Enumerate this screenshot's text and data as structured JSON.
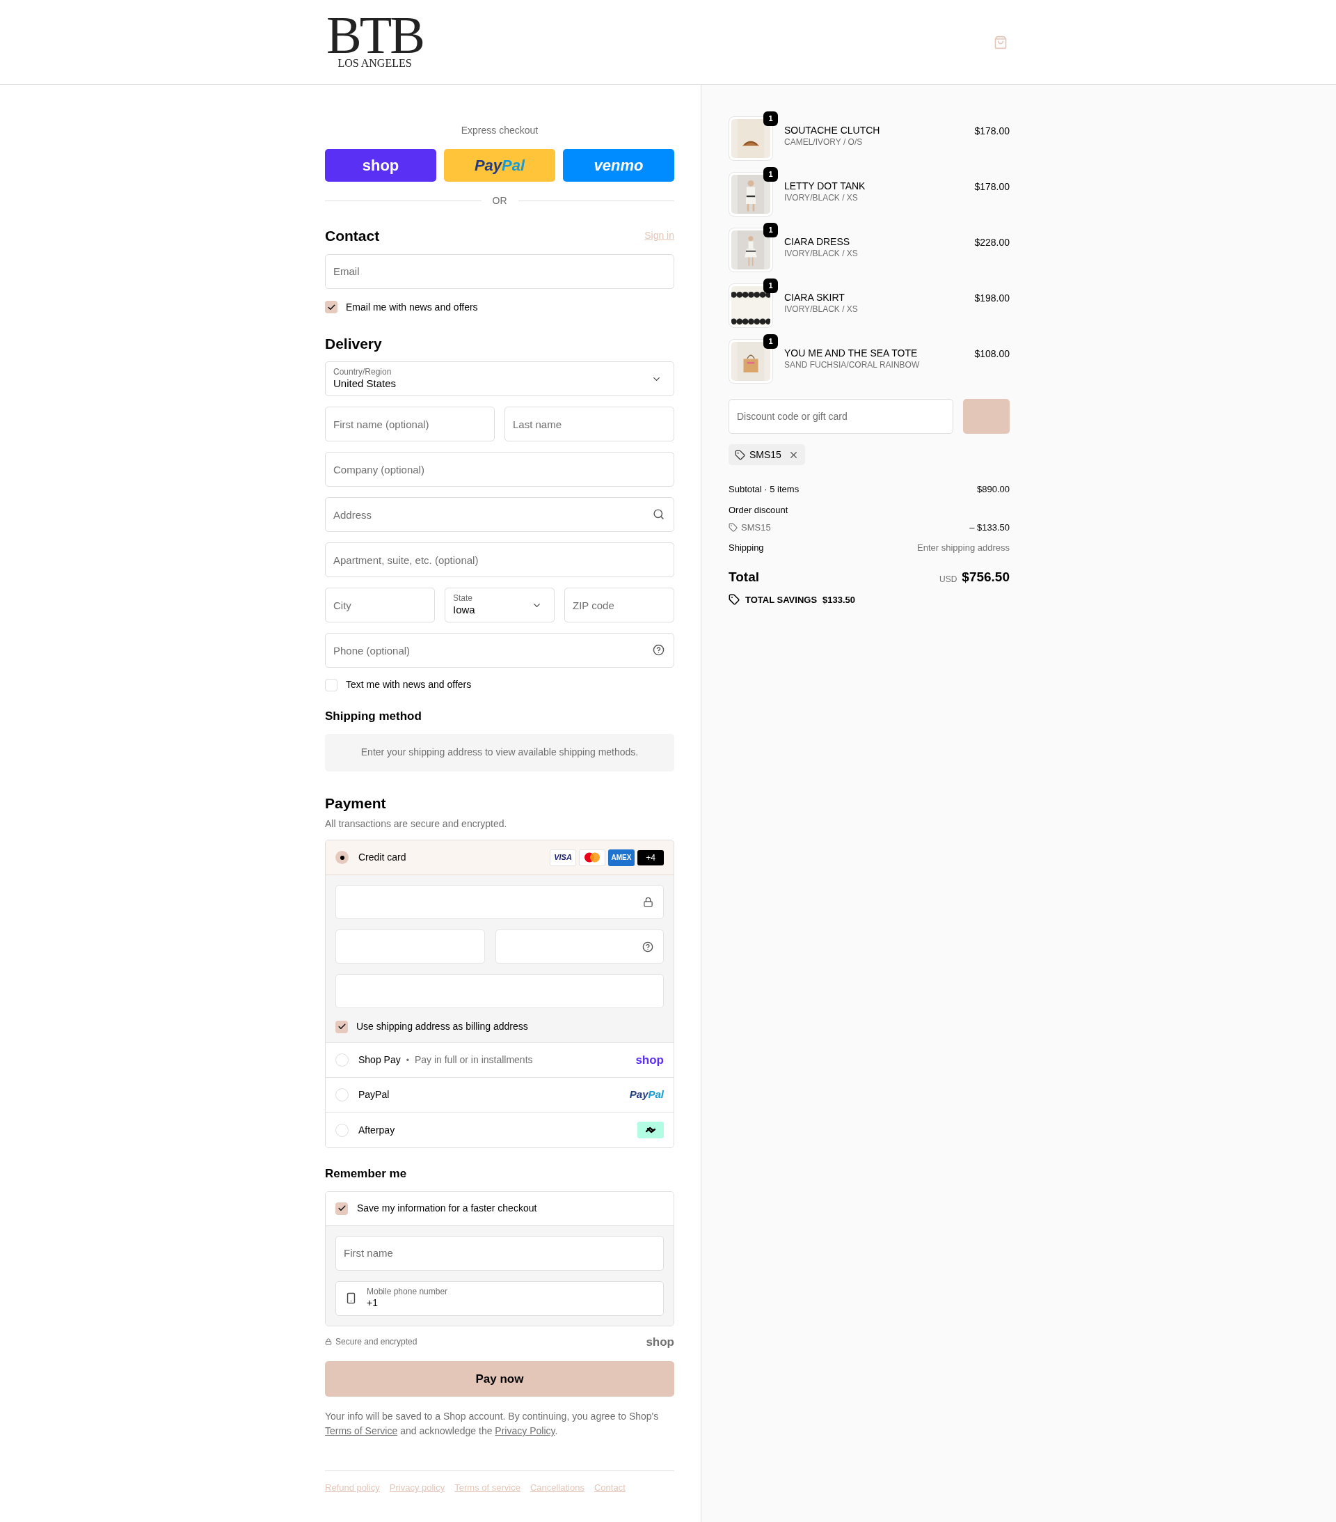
{
  "header": {
    "logo": "BTB",
    "logo_subtitle": "LOS ANGELES"
  },
  "express": {
    "title": "Express checkout",
    "buttons": [
      {
        "kind": "shop",
        "parts": [
          "shop"
        ]
      },
      {
        "kind": "paypal",
        "parts": [
          "Pay",
          "Pal"
        ]
      },
      {
        "kind": "venmo",
        "parts": [
          "venmo"
        ]
      }
    ],
    "divider": "OR"
  },
  "contact": {
    "title": "Contact",
    "sign_in": "Sign in",
    "email": {
      "placeholder": "Email"
    },
    "news": {
      "label": "Email me with news and offers",
      "checked": true
    }
  },
  "delivery": {
    "title": "Delivery",
    "rows": [
      [
        {
          "kind": "select",
          "label": "Country/Region",
          "value": "United States"
        }
      ],
      [
        {
          "kind": "input",
          "placeholder": "First name (optional)"
        },
        {
          "kind": "input",
          "placeholder": "Last name"
        }
      ],
      [
        {
          "kind": "input",
          "placeholder": "Company (optional)"
        }
      ],
      [
        {
          "kind": "search",
          "placeholder": "Address"
        }
      ],
      [
        {
          "kind": "input",
          "placeholder": "Apartment, suite, etc. (optional)"
        }
      ],
      [
        {
          "kind": "input",
          "placeholder": "City"
        },
        {
          "kind": "select",
          "label": "State",
          "value": "Iowa"
        },
        {
          "kind": "input",
          "placeholder": "ZIP code"
        }
      ],
      [
        {
          "kind": "help",
          "placeholder": "Phone (optional)"
        }
      ]
    ],
    "text_news": {
      "label": "Text me with news and offers",
      "checked": false
    }
  },
  "shipping_method": {
    "title": "Shipping method",
    "message": "Enter your shipping address to view available shipping methods."
  },
  "payment": {
    "title": "Payment",
    "subtitle": "All transactions are secure and encrypted.",
    "methods": [
      {
        "kind": "card",
        "label": "Credit card",
        "selected": true,
        "brands": [
          {
            "kind": "visa",
            "label": "VISA"
          },
          {
            "kind": "mastercard"
          },
          {
            "kind": "amex",
            "label": "AMEX"
          },
          {
            "kind": "more",
            "label": "+4"
          }
        ],
        "billing": {
          "label": "Use shipping address as billing address",
          "checked": true
        }
      },
      {
        "kind": "shop",
        "label": "Shop Pay",
        "separator": "•",
        "note": "Pay in full or in installments",
        "selected": false,
        "logo": [
          "shop"
        ]
      },
      {
        "kind": "paypal",
        "label": "PayPal",
        "selected": false,
        "logo": [
          "Pay",
          "Pal"
        ]
      },
      {
        "kind": "afterpay",
        "label": "Afterpay",
        "selected": false
      }
    ]
  },
  "remember": {
    "title": "Remember me",
    "save": {
      "label": "Save my information for a faster checkout",
      "checked": true
    },
    "first_name": {
      "placeholder": "First name"
    },
    "phone": {
      "label": "Mobile phone number",
      "value": "+1"
    }
  },
  "secure": {
    "label": "Secure and encrypted",
    "logo": "shop"
  },
  "pay_button": "Pay now",
  "legal": {
    "before": "Your info will be saved to a Shop account. By continuing, you agree to Shop's ",
    "link1": "Terms of Service",
    "middle": " and acknowledge the ",
    "link2": "Privacy Policy",
    "after": "."
  },
  "footer_links": [
    "Refund policy",
    "Privacy policy",
    "Terms of service",
    "Cancellations",
    "Contact"
  ],
  "items": [
    {
      "name": "SOUTACHE CLUTCH",
      "variant": "CAMEL/IVORY / O/S",
      "price": "$178.00",
      "quantity": "1"
    },
    {
      "name": "LETTY DOT TANK",
      "variant": "IVORY/BLACK / XS",
      "price": "$178.00",
      "quantity": "1"
    },
    {
      "name": "CIARA DRESS",
      "variant": "IVORY/BLACK / XS",
      "price": "$228.00",
      "quantity": "1"
    },
    {
      "name": "CIARA SKIRT",
      "variant": "IVORY/BLACK / XS",
      "price": "$198.00",
      "quantity": "1"
    },
    {
      "name": "YOU ME AND THE SEA TOTE",
      "variant": "SAND FUCHSIA/CORAL RAINBOW",
      "price": "$108.00",
      "quantity": "1"
    }
  ],
  "discount": {
    "placeholder": "Discount code or gift card",
    "code": "SMS15"
  },
  "summary": {
    "subtotal_label": "Subtotal · 5 items",
    "subtotal": "$890.00",
    "discount_label": "Order discount",
    "discount_code": "SMS15",
    "discount_amount": "– $133.50",
    "shipping_label": "Shipping",
    "shipping_value": "Enter shipping address",
    "total_label": "Total",
    "currency": "USD",
    "total": "$756.50",
    "savings_label": "TOTAL SAVINGS",
    "savings": "$133.50"
  }
}
